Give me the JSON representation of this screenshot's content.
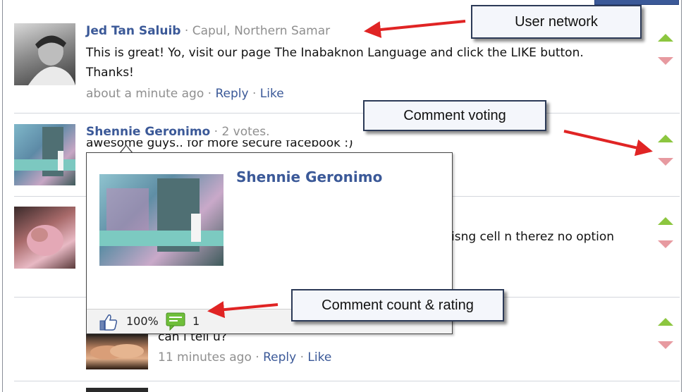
{
  "comments": [
    {
      "name": "Jed Tan Saluib",
      "sep": " · ",
      "network": "Capul, Northern Samar",
      "text_line1": "This is great! Yo, visit our page The Inabaknon Language and click the LIKE button.",
      "text_line2": "Thanks!",
      "time": "about a minute ago",
      "reply": "Reply",
      "like": "Like",
      "dot": " · "
    },
    {
      "name": "Shennie Geronimo",
      "sep": " · ",
      "votes": "2 votes.",
      "text_partial": "awesome guys.. for more secure facebook :)"
    },
    {
      "text_partial": "isng cell n therez no option"
    },
    {
      "text_partial": "can i tell u?",
      "time": "11 minutes ago",
      "reply": "Reply",
      "like": "Like",
      "dot": " · "
    }
  ],
  "popup": {
    "name": "Shennie Geronimo",
    "rating": "100%",
    "comment_count": "1"
  },
  "callouts": {
    "user_network": "User network",
    "comment_voting": "Comment voting",
    "count_rating": "Comment count & rating"
  },
  "colors": {
    "link": "#3b5998",
    "vote_up": "#8cc63f",
    "vote_down": "#e79aa0",
    "arrow": "#e02424"
  },
  "icons": [
    "thumbs-up-icon",
    "comment-bubble-icon",
    "vote-up-icon",
    "vote-down-icon"
  ]
}
